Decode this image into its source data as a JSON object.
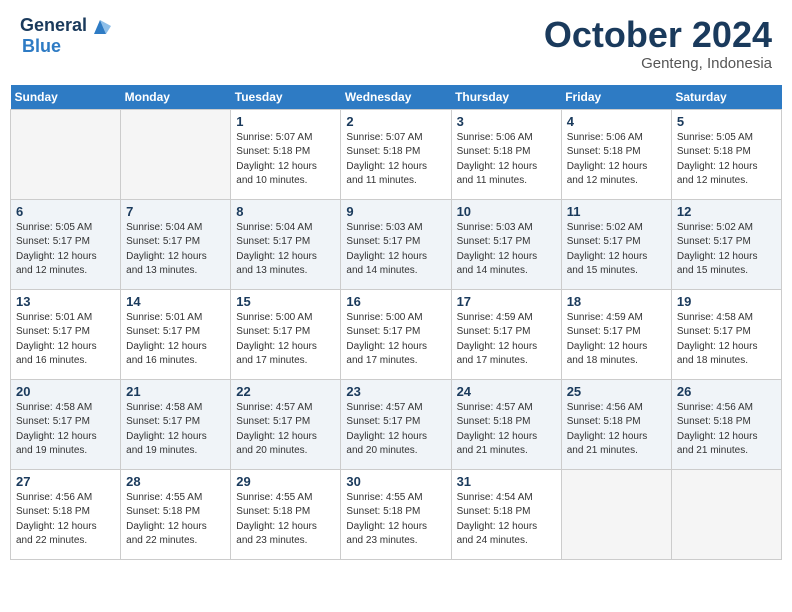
{
  "header": {
    "logo_general": "General",
    "logo_blue": "Blue",
    "month": "October 2024",
    "location": "Genteng, Indonesia"
  },
  "days_of_week": [
    "Sunday",
    "Monday",
    "Tuesday",
    "Wednesday",
    "Thursday",
    "Friday",
    "Saturday"
  ],
  "weeks": [
    [
      {
        "day": "",
        "empty": true
      },
      {
        "day": "",
        "empty": true
      },
      {
        "day": "1",
        "sunrise": "5:07 AM",
        "sunset": "5:18 PM",
        "daylight": "12 hours and 10 minutes."
      },
      {
        "day": "2",
        "sunrise": "5:07 AM",
        "sunset": "5:18 PM",
        "daylight": "12 hours and 11 minutes."
      },
      {
        "day": "3",
        "sunrise": "5:06 AM",
        "sunset": "5:18 PM",
        "daylight": "12 hours and 11 minutes."
      },
      {
        "day": "4",
        "sunrise": "5:06 AM",
        "sunset": "5:18 PM",
        "daylight": "12 hours and 12 minutes."
      },
      {
        "day": "5",
        "sunrise": "5:05 AM",
        "sunset": "5:18 PM",
        "daylight": "12 hours and 12 minutes."
      }
    ],
    [
      {
        "day": "6",
        "sunrise": "5:05 AM",
        "sunset": "5:17 PM",
        "daylight": "12 hours and 12 minutes."
      },
      {
        "day": "7",
        "sunrise": "5:04 AM",
        "sunset": "5:17 PM",
        "daylight": "12 hours and 13 minutes."
      },
      {
        "day": "8",
        "sunrise": "5:04 AM",
        "sunset": "5:17 PM",
        "daylight": "12 hours and 13 minutes."
      },
      {
        "day": "9",
        "sunrise": "5:03 AM",
        "sunset": "5:17 PM",
        "daylight": "12 hours and 14 minutes."
      },
      {
        "day": "10",
        "sunrise": "5:03 AM",
        "sunset": "5:17 PM",
        "daylight": "12 hours and 14 minutes."
      },
      {
        "day": "11",
        "sunrise": "5:02 AM",
        "sunset": "5:17 PM",
        "daylight": "12 hours and 15 minutes."
      },
      {
        "day": "12",
        "sunrise": "5:02 AM",
        "sunset": "5:17 PM",
        "daylight": "12 hours and 15 minutes."
      }
    ],
    [
      {
        "day": "13",
        "sunrise": "5:01 AM",
        "sunset": "5:17 PM",
        "daylight": "12 hours and 16 minutes."
      },
      {
        "day": "14",
        "sunrise": "5:01 AM",
        "sunset": "5:17 PM",
        "daylight": "12 hours and 16 minutes."
      },
      {
        "day": "15",
        "sunrise": "5:00 AM",
        "sunset": "5:17 PM",
        "daylight": "12 hours and 17 minutes."
      },
      {
        "day": "16",
        "sunrise": "5:00 AM",
        "sunset": "5:17 PM",
        "daylight": "12 hours and 17 minutes."
      },
      {
        "day": "17",
        "sunrise": "4:59 AM",
        "sunset": "5:17 PM",
        "daylight": "12 hours and 17 minutes."
      },
      {
        "day": "18",
        "sunrise": "4:59 AM",
        "sunset": "5:17 PM",
        "daylight": "12 hours and 18 minutes."
      },
      {
        "day": "19",
        "sunrise": "4:58 AM",
        "sunset": "5:17 PM",
        "daylight": "12 hours and 18 minutes."
      }
    ],
    [
      {
        "day": "20",
        "sunrise": "4:58 AM",
        "sunset": "5:17 PM",
        "daylight": "12 hours and 19 minutes."
      },
      {
        "day": "21",
        "sunrise": "4:58 AM",
        "sunset": "5:17 PM",
        "daylight": "12 hours and 19 minutes."
      },
      {
        "day": "22",
        "sunrise": "4:57 AM",
        "sunset": "5:17 PM",
        "daylight": "12 hours and 20 minutes."
      },
      {
        "day": "23",
        "sunrise": "4:57 AM",
        "sunset": "5:17 PM",
        "daylight": "12 hours and 20 minutes."
      },
      {
        "day": "24",
        "sunrise": "4:57 AM",
        "sunset": "5:18 PM",
        "daylight": "12 hours and 21 minutes."
      },
      {
        "day": "25",
        "sunrise": "4:56 AM",
        "sunset": "5:18 PM",
        "daylight": "12 hours and 21 minutes."
      },
      {
        "day": "26",
        "sunrise": "4:56 AM",
        "sunset": "5:18 PM",
        "daylight": "12 hours and 21 minutes."
      }
    ],
    [
      {
        "day": "27",
        "sunrise": "4:56 AM",
        "sunset": "5:18 PM",
        "daylight": "12 hours and 22 minutes."
      },
      {
        "day": "28",
        "sunrise": "4:55 AM",
        "sunset": "5:18 PM",
        "daylight": "12 hours and 22 minutes."
      },
      {
        "day": "29",
        "sunrise": "4:55 AM",
        "sunset": "5:18 PM",
        "daylight": "12 hours and 23 minutes."
      },
      {
        "day": "30",
        "sunrise": "4:55 AM",
        "sunset": "5:18 PM",
        "daylight": "12 hours and 23 minutes."
      },
      {
        "day": "31",
        "sunrise": "4:54 AM",
        "sunset": "5:18 PM",
        "daylight": "12 hours and 24 minutes."
      },
      {
        "day": "",
        "empty": true
      },
      {
        "day": "",
        "empty": true
      }
    ]
  ],
  "labels": {
    "sunrise": "Sunrise:",
    "sunset": "Sunset:",
    "daylight": "Daylight:"
  }
}
